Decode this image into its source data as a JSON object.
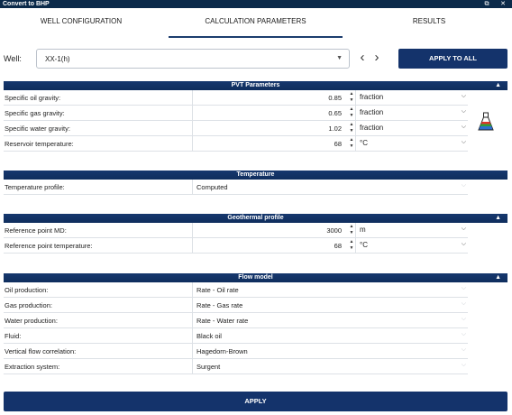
{
  "window": {
    "title": "Convert to BHP",
    "restore_icon": "restore-icon",
    "close_icon": "close-icon"
  },
  "tabs": [
    {
      "label": "WELL CONFIGURATION"
    },
    {
      "label": "CALCULATION PARAMETERS",
      "active": true
    },
    {
      "label": "RESULTS"
    }
  ],
  "well": {
    "label": "Well:",
    "value": "XX-1(h)",
    "prev_icon": "chevron-left-icon",
    "next_icon": "chevron-right-icon",
    "apply_all_label": "APPLY TO ALL"
  },
  "pvt": {
    "title": "PVT Parameters",
    "rows": [
      {
        "label": "Specific oil gravity:",
        "value": "0.85",
        "unit": "fraction"
      },
      {
        "label": "Specific gas gravity:",
        "value": "0.65",
        "unit": "fraction"
      },
      {
        "label": "Specific water gravity:",
        "value": "1.02",
        "unit": "fraction"
      },
      {
        "label": "Reservoir temperature:",
        "value": "68",
        "unit": "°C"
      }
    ]
  },
  "temperature": {
    "title": "Temperature",
    "rows": [
      {
        "label": "Temperature profile:",
        "value": "Computed"
      }
    ]
  },
  "geothermal": {
    "title": "Geothermal profile",
    "rows": [
      {
        "label": "Reference point MD:",
        "value": "3000",
        "unit": "m"
      },
      {
        "label": "Reference point temperature:",
        "value": "68",
        "unit": "°C"
      }
    ]
  },
  "flow": {
    "title": "Flow model",
    "rows": [
      {
        "label": "Oil production:",
        "value": "Rate - Oil rate"
      },
      {
        "label": "Gas production:",
        "value": "Rate - Gas rate"
      },
      {
        "label": "Water production:",
        "value": "Rate - Water rate"
      },
      {
        "label": "Fluid:",
        "value": "Black oil"
      },
      {
        "label": "Vertical flow correlation:",
        "value": "Hagedorn-Brown"
      },
      {
        "label": "Extraction system:",
        "value": "Surgent"
      }
    ]
  },
  "apply_label": "APPLY",
  "colors": {
    "header": "#14336b",
    "titlebar": "#0b2a4a",
    "row_border": "#dde1e6"
  }
}
